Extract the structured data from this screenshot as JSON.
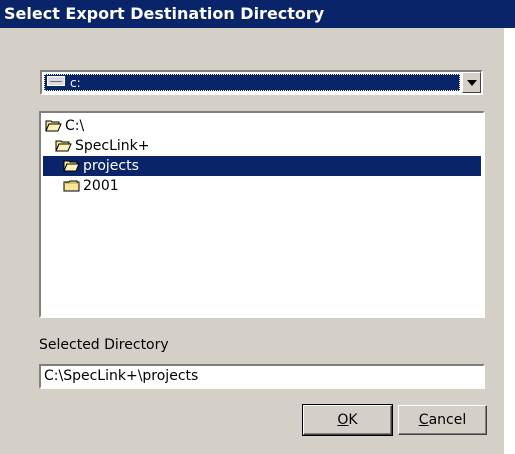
{
  "window": {
    "title": "Select Export Destination Directory"
  },
  "drive": {
    "selected_label": "c:",
    "icon": "drive-icon"
  },
  "directories": [
    {
      "label": "C:\\",
      "icon": "open-folder-icon",
      "selected": false
    },
    {
      "label": "SpecLink+",
      "icon": "open-folder-icon",
      "selected": false
    },
    {
      "label": "projects",
      "icon": "open-folder-icon",
      "selected": true
    },
    {
      "label": "2001",
      "icon": "folder-icon",
      "selected": false
    }
  ],
  "selected_directory": {
    "label": "Selected Directory",
    "value": "C:\\SpecLink+\\projects"
  },
  "buttons": {
    "ok": {
      "mnemonic": "O",
      "rest": "K"
    },
    "cancel": {
      "mnemonic": "C",
      "rest": "ancel"
    }
  },
  "colors": {
    "titlebar": "#0a246a",
    "selection": "#0a246a",
    "dialog_face": "#d4d0c8"
  }
}
